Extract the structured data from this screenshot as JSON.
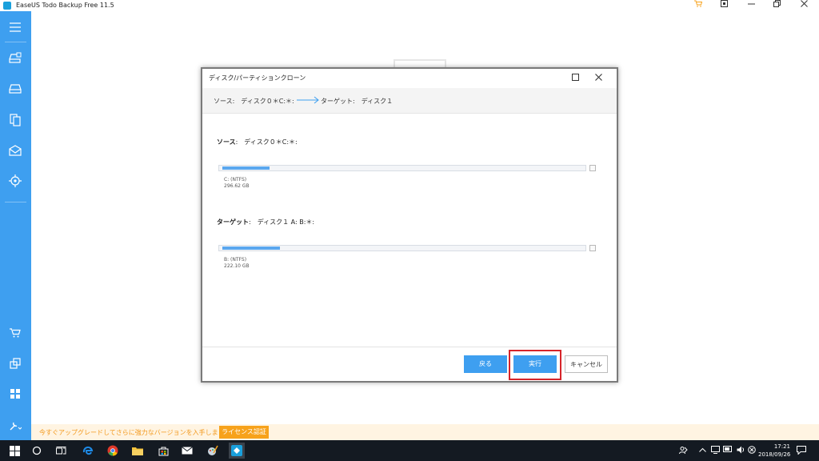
{
  "app": {
    "title": "EaseUS Todo Backup Free 11.5",
    "brand_color": "#3e9ff0",
    "accent_color": "#f7a21b"
  },
  "titlebar": {
    "icons": [
      "cart-icon",
      "pin-icon",
      "minimize-icon",
      "maximize-icon",
      "close-icon"
    ]
  },
  "sidebar": {
    "items": [
      {
        "icon": "menu-icon"
      },
      {
        "icon": "disk-backup-icon"
      },
      {
        "icon": "system-backup-icon"
      },
      {
        "icon": "file-backup-icon"
      },
      {
        "icon": "mail-backup-icon"
      },
      {
        "icon": "smart-backup-icon"
      },
      {
        "icon": "cart-icon"
      },
      {
        "icon": "clone-icon"
      },
      {
        "icon": "apps-icon"
      },
      {
        "icon": "tools-icon"
      }
    ]
  },
  "dialog": {
    "title": "ディスク/パーティションクローン",
    "summary": {
      "source": "ソース:　ディスク０＊C:＊:",
      "target": "ターゲット:　ディスク１"
    },
    "source_section": {
      "label_bold": "ソース",
      "label_rest": ":　ディスク０＊C:＊:",
      "partition_name": "C: (NTFS)",
      "partition_size": "296.62 GB",
      "fill_fraction": 0.13
    },
    "target_section": {
      "label_bold": "ターゲット",
      "label_rest": ":　ディスク１ A: B:＊:",
      "partition_name": "B: (NTFS)",
      "partition_size": "222.10 GB",
      "fill_fraction": 0.16
    },
    "buttons": {
      "back": "戻る",
      "execute": "実行",
      "cancel": "キャンセル"
    }
  },
  "upgrade_bar": {
    "text": "今すぐアップグレードしてさらに強力なバージョンを入手しましょう。",
    "license_button": "ライセンス認証"
  },
  "taskbar": {
    "time": "17:21",
    "date": "2018/09/26"
  }
}
